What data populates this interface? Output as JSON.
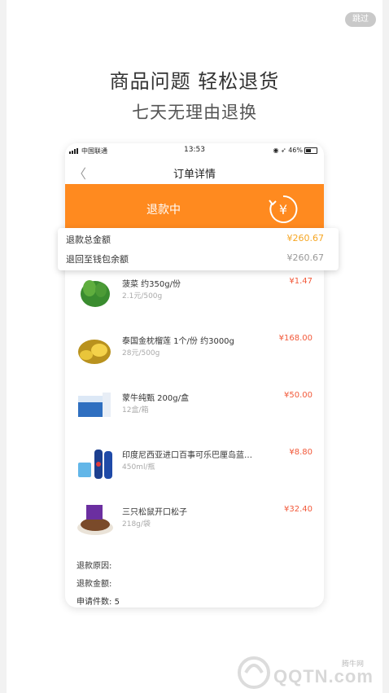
{
  "skip_label": "跳过",
  "headline": "商品问题  轻松退货",
  "subline": "七天无理由退换",
  "status": {
    "carrier": "中国联通",
    "time": "13:53",
    "battery": "46%"
  },
  "nav": {
    "title": "订单详情"
  },
  "banner": {
    "text": "退款中"
  },
  "refund": {
    "total_label": "退款总金额",
    "total_value": "¥260.67",
    "wallet_label": "退回至钱包余额",
    "wallet_value": "¥260.67"
  },
  "items": [
    {
      "name": "菠菜  约350g/份",
      "price": "¥1.47",
      "sub": "2.1元/500g"
    },
    {
      "name": "泰国金枕榴莲  1个/份 约3000g",
      "price": "¥168.00",
      "sub": "28元/500g"
    },
    {
      "name": "蒙牛纯甄  200g/盒",
      "price": "¥50.00",
      "sub": "12盒/箱"
    },
    {
      "name": "印度尼西亚进口百事可乐巴厘岛蓝…",
      "price": "¥8.80",
      "sub": "450ml/瓶"
    },
    {
      "name": "三只松鼠开口松子",
      "price": "¥32.40",
      "sub": "218g/袋"
    }
  ],
  "footer": {
    "reason_label": "退款原因:",
    "amount_label": "退款金额:",
    "count_label": "申请件数:",
    "count_value": "5"
  },
  "watermark": {
    "text": "QQTN.com",
    "small": "腾牛网"
  },
  "colors": {
    "accent": "#ff8a1f",
    "price": "#f2593a",
    "amount": "#f6a623"
  }
}
